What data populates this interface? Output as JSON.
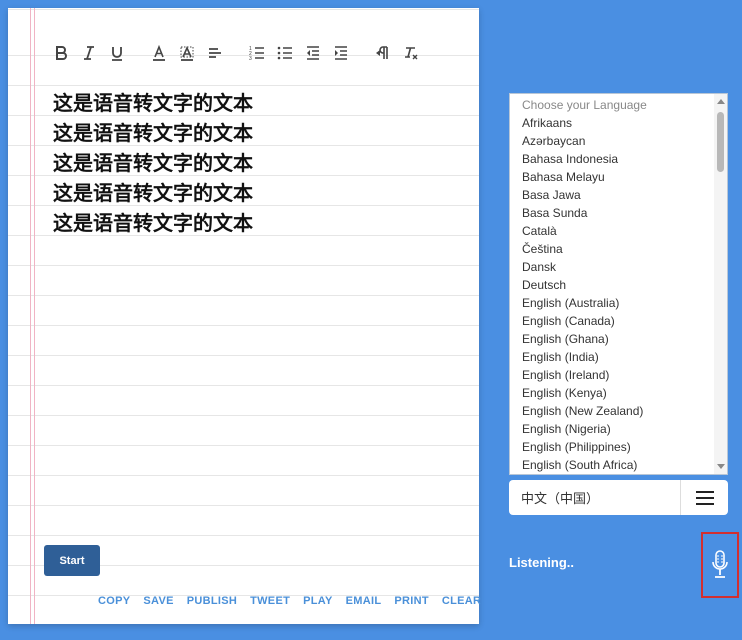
{
  "toolbar": {
    "buttons": [
      {
        "name": "bold",
        "icon": "bold-icon"
      },
      {
        "name": "italic",
        "icon": "italic-icon"
      },
      {
        "name": "underline",
        "icon": "underline-icon"
      },
      {
        "name": "font-color",
        "icon": "font-color-icon"
      },
      {
        "name": "highlight",
        "icon": "highlight-icon"
      },
      {
        "name": "align-left",
        "icon": "align-left-icon"
      },
      {
        "name": "ordered-list",
        "icon": "ordered-list-icon"
      },
      {
        "name": "bullet-list",
        "icon": "bullet-list-icon"
      },
      {
        "name": "outdent",
        "icon": "outdent-icon"
      },
      {
        "name": "indent",
        "icon": "indent-icon"
      },
      {
        "name": "rtl",
        "icon": "paragraph-rtl-icon"
      },
      {
        "name": "clear-format",
        "icon": "clear-format-icon"
      }
    ]
  },
  "editor": {
    "lines": [
      "这是语音转文字的文本",
      "这是语音转文字的文本",
      "这是语音转文字的文本",
      "这是语音转文字的文本",
      "这是语音转文字的文本"
    ]
  },
  "controls": {
    "start_label": "Start",
    "actions": [
      "COPY",
      "SAVE",
      "PUBLISH",
      "TWEET",
      "PLAY",
      "EMAIL",
      "PRINT",
      "CLEAR"
    ]
  },
  "language": {
    "placeholder": "Choose your Language",
    "options": [
      "Afrikaans",
      "Azərbaycan",
      "Bahasa Indonesia",
      "Bahasa Melayu",
      "Basa Jawa",
      "Basa Sunda",
      "Català",
      "Čeština",
      "Dansk",
      "Deutsch",
      "English (Australia)",
      "English (Canada)",
      "English (Ghana)",
      "English (India)",
      "English (Ireland)",
      "English (Kenya)",
      "English (New Zealand)",
      "English (Nigeria)",
      "English (Philippines)",
      "English (South Africa)"
    ],
    "dialect": "中文（中国）"
  },
  "status": {
    "text": "Listening..",
    "mic_icon": "microphone-icon"
  },
  "colors": {
    "background": "#4a8fe2",
    "start_button": "#2f5f97",
    "action_link": "#4a90d9",
    "mic_highlight": "#d32f2f"
  }
}
